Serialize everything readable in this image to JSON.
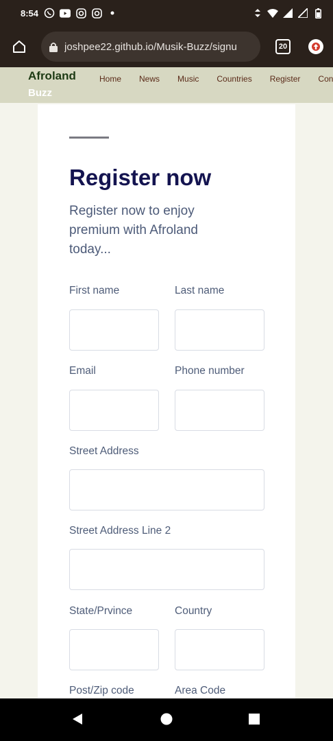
{
  "status_bar": {
    "time": "8:54",
    "icons": [
      "whatsapp-icon",
      "youtube-icon",
      "instagram-icon",
      "instagram-icon",
      "dot-icon"
    ],
    "right_icons": [
      "vibrate-icon",
      "wifi-icon",
      "signal-icon",
      "signal-icon",
      "battery-icon"
    ]
  },
  "browser": {
    "url": "joshpee22.github.io/Musik-Buzz/signu",
    "tab_count": "20"
  },
  "site": {
    "brand_line1": "Afroland",
    "brand_line2": "Buzz",
    "nav": [
      "Home",
      "News",
      "Music",
      "Countries",
      "Register",
      "Conta"
    ]
  },
  "form": {
    "title": "Register now",
    "subtitle": "Register now to enjoy premium with Afroland today...",
    "fields": {
      "first_name": "First name",
      "last_name": "Last name",
      "email": "Email",
      "phone": "Phone number",
      "street": "Street Address",
      "street2": "Street Address Line 2",
      "state": "State/Prvince",
      "country": "Country",
      "zip": "Post/Zip code",
      "area_code": "Area Code"
    }
  },
  "colors": {
    "accent_title": "#141450",
    "nav_bg": "#d7d8c2",
    "brand": "#1d3a14",
    "nav_link": "#5a2a18"
  }
}
